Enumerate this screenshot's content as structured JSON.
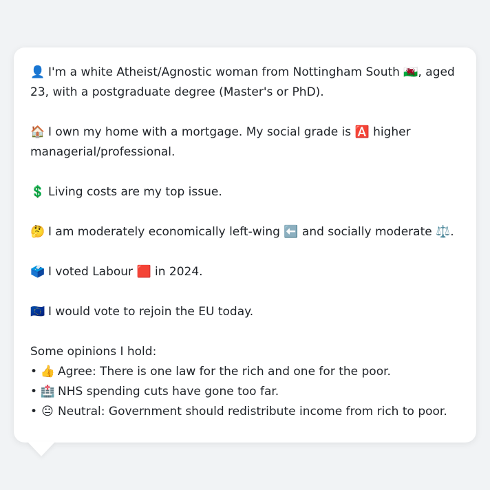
{
  "profile": {
    "demographics": {
      "icon": "person-silhouette-icon",
      "glyph": "👤",
      "text": "I'm a white Atheist/Agnostic woman from Nottingham South 🏴󠁧󠁢󠁷󠁬󠁳󠁿, aged 23, with a postgraduate degree (Master's or PhD)."
    },
    "housing": {
      "icon": "house-icon",
      "glyph": "🏠",
      "text": "I own my home with a mortgage. My social grade is 🅰️ higher managerial/professional."
    },
    "issue": {
      "icon": "dollar-sign-icon",
      "glyph": "💲",
      "text": "Living costs are my top issue."
    },
    "ideology": {
      "icon": "thinking-face-icon",
      "glyph": "🤔",
      "text": "I am moderately economically left-wing ⬅️ and socially moderate ⚖️."
    },
    "vote": {
      "icon": "ballot-box-icon",
      "glyph": "🗳️",
      "text": "I voted Labour 🟥 in 2024."
    },
    "eu": {
      "icon": "eu-flag-icon",
      "glyph": "🇪🇺",
      "text": "I would vote to rejoin the EU today."
    },
    "opinions_heading": "Some opinions I hold:",
    "opinions": [
      {
        "icon": "thumbs-up-icon",
        "glyph": "👍",
        "text": "Agree: There is one law for the rich and one for the poor."
      },
      {
        "icon": "hospital-icon",
        "glyph": "🏥",
        "text": "NHS spending cuts have gone too far."
      },
      {
        "icon": "neutral-face-icon",
        "glyph": "😐",
        "text": "Neutral: Government should redistribute income from rich to poor."
      }
    ],
    "bullet": "•"
  },
  "colors": {
    "background": "#f1f3f5",
    "bubble": "#ffffff",
    "text": "#1f2328"
  }
}
